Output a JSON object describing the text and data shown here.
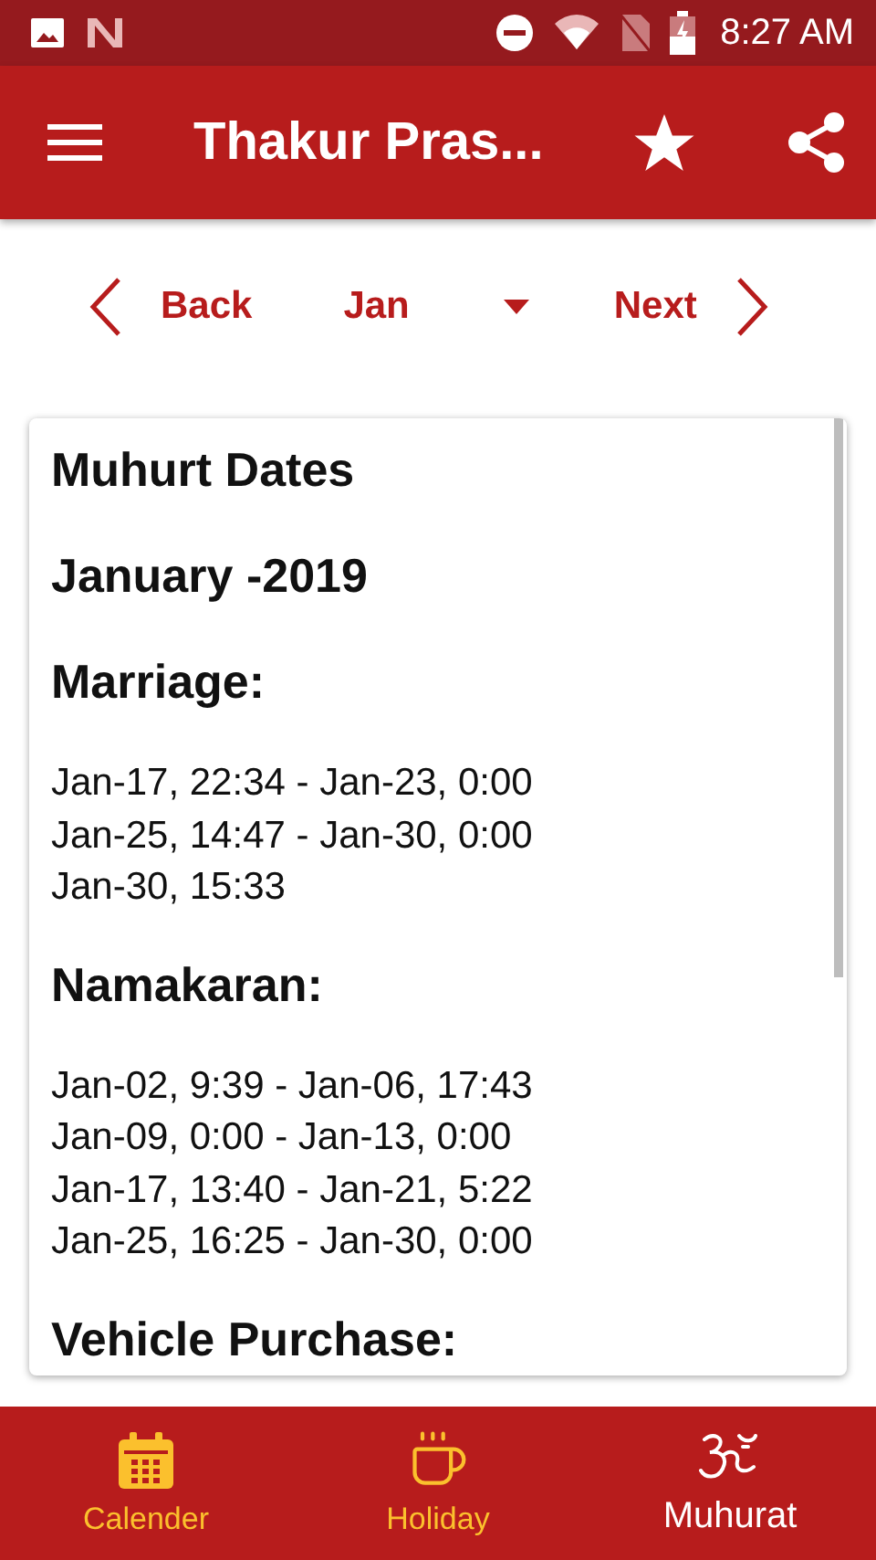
{
  "status_bar": {
    "time": "8:27 AM"
  },
  "app_bar": {
    "title": "Thakur Pras..."
  },
  "month_nav": {
    "back": "Back",
    "month": "Jan",
    "next": "Next"
  },
  "card": {
    "title": "Muhurt Dates",
    "subtitle": "January -2019",
    "sections": [
      {
        "heading": "Marriage:",
        "lines": [
          "Jan-17, 22:34 - Jan-23, 0:00",
          "Jan-25, 14:47 - Jan-30, 0:00",
          "Jan-30, 15:33"
        ]
      },
      {
        "heading": "Namakaran:",
        "lines": [
          "Jan-02, 9:39 - Jan-06, 17:43",
          "Jan-09, 0:00 - Jan-13, 0:00",
          "Jan-17, 13:40 - Jan-21, 5:22",
          "Jan-25, 16:25 - Jan-30, 0:00"
        ]
      },
      {
        "heading": "Vehicle Purchase:"
      }
    ]
  },
  "bottom_nav": [
    {
      "kind": "calendar",
      "label": "Calender",
      "selected": false
    },
    {
      "kind": "cup",
      "label": "Holiday",
      "selected": false
    },
    {
      "kind": "om",
      "label": "Muhurat",
      "selected": true
    }
  ]
}
